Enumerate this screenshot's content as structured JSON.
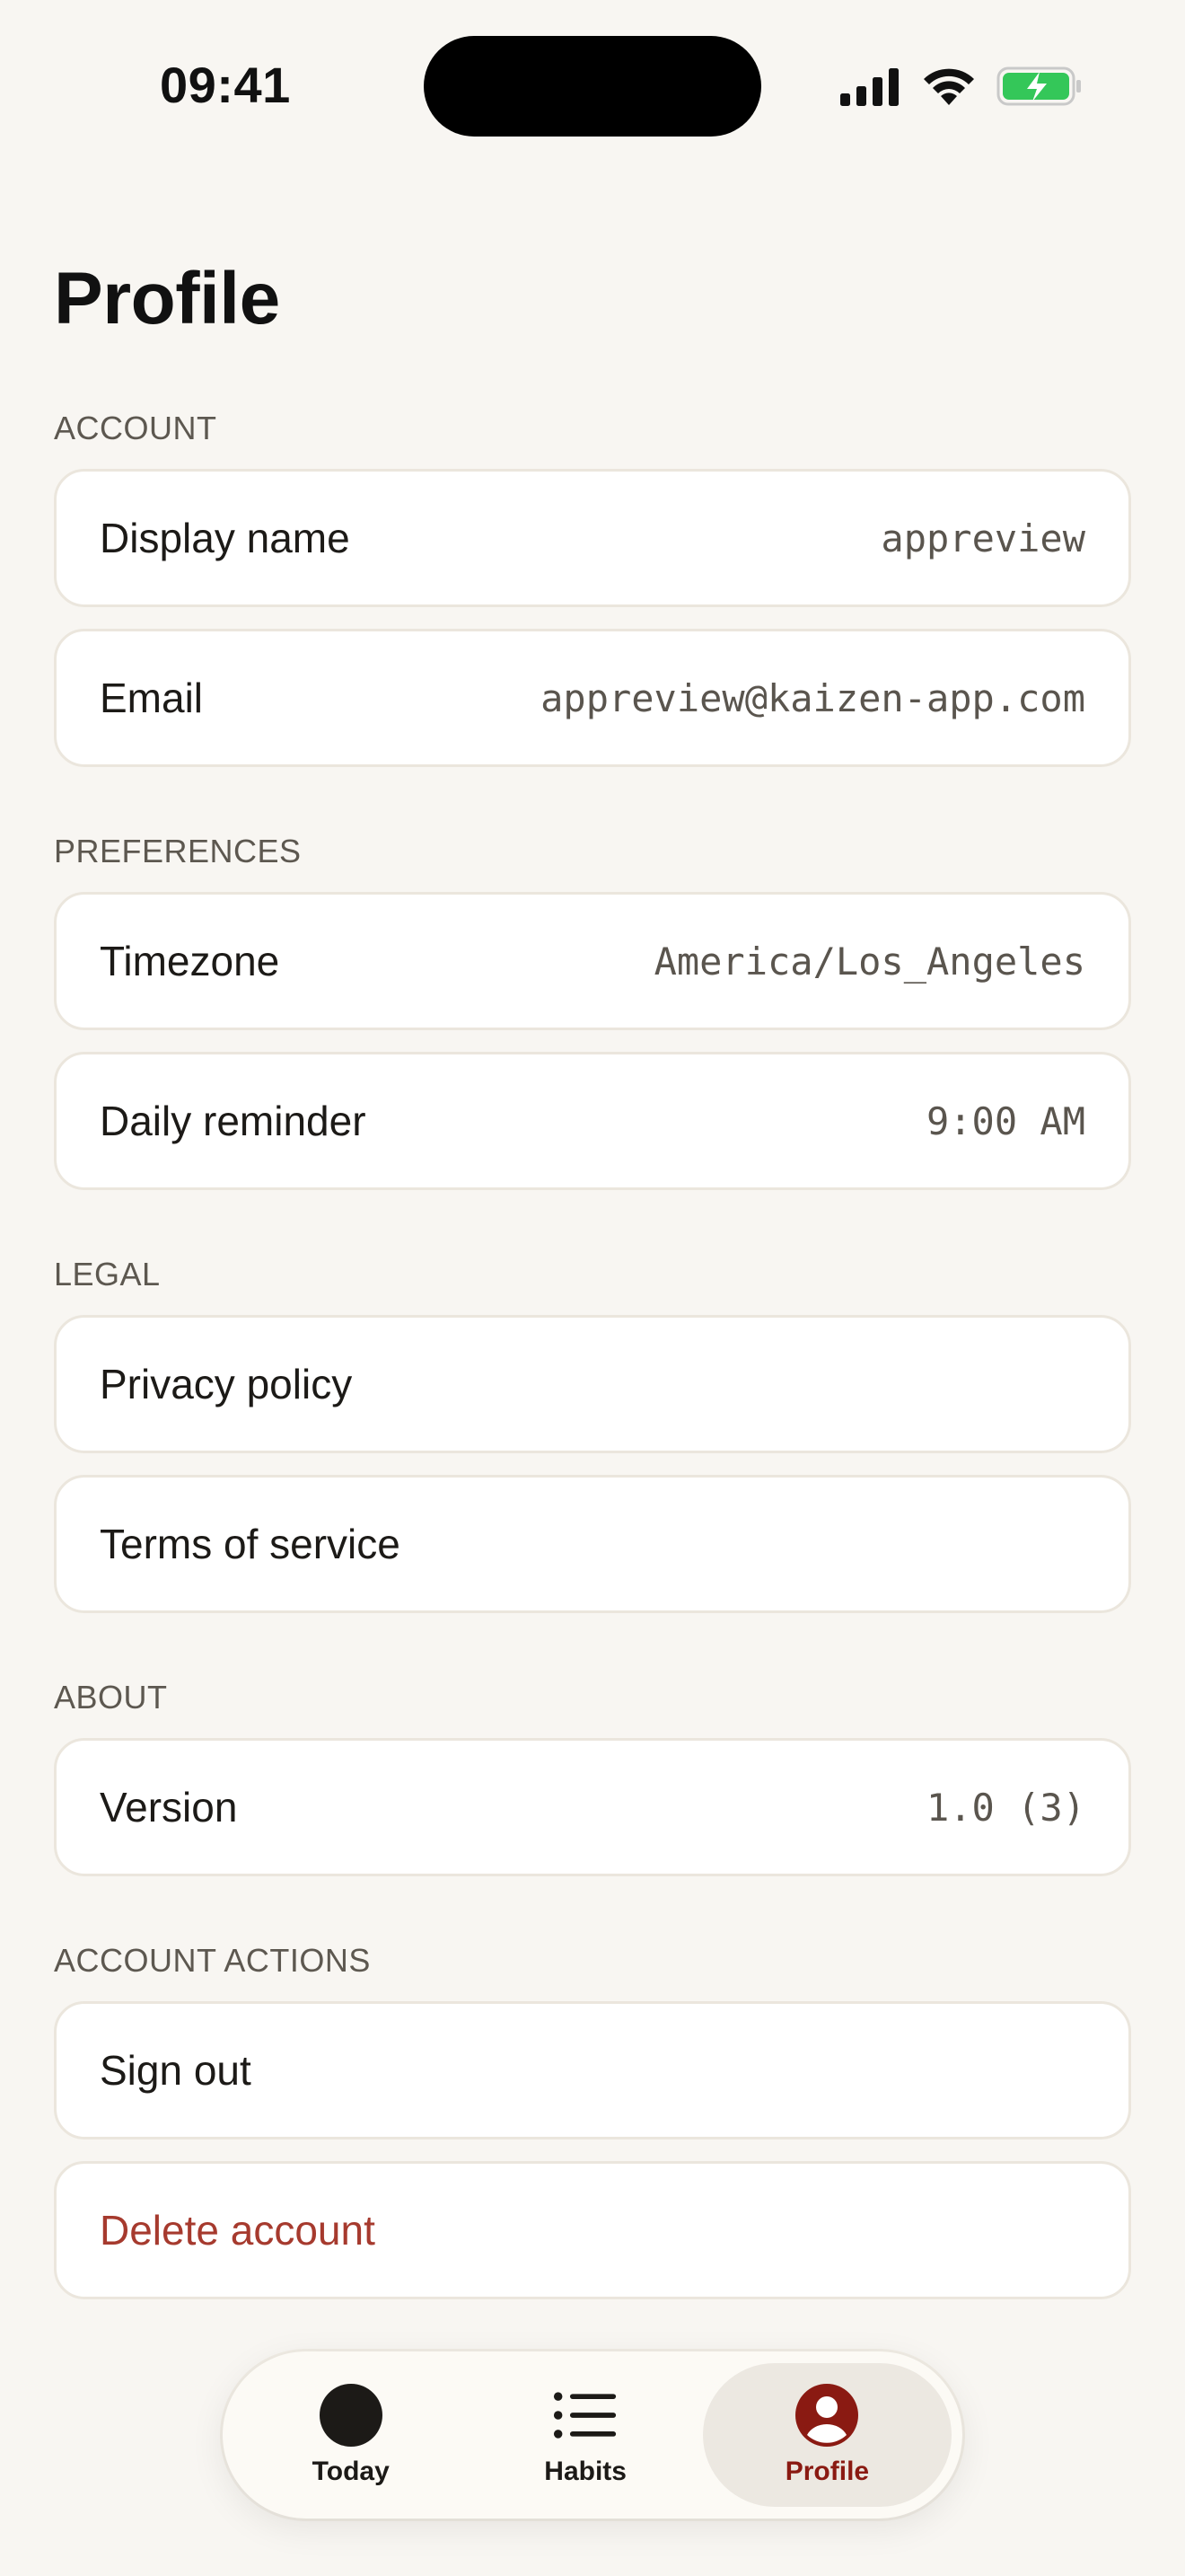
{
  "status_bar": {
    "time": "09:41"
  },
  "page": {
    "title": "Profile"
  },
  "sections": {
    "account": {
      "label": "ACCOUNT",
      "rows": [
        {
          "label": "Display name",
          "value": "appreview"
        },
        {
          "label": "Email",
          "value": "appreview@kaizen-app.com"
        }
      ]
    },
    "preferences": {
      "label": "PREFERENCES",
      "rows": [
        {
          "label": "Timezone",
          "value": "America/Los_Angeles"
        },
        {
          "label": "Daily reminder",
          "value": "9:00 AM"
        }
      ]
    },
    "legal": {
      "label": "LEGAL",
      "rows": [
        {
          "label": "Privacy policy"
        },
        {
          "label": "Terms of service"
        }
      ]
    },
    "about": {
      "label": "ABOUT",
      "rows": [
        {
          "label": "Version",
          "value": "1.0 (3)"
        }
      ]
    },
    "account_actions": {
      "label": "ACCOUNT ACTIONS",
      "rows": [
        {
          "label": "Sign out"
        },
        {
          "label": "Delete account"
        }
      ]
    }
  },
  "tab_bar": {
    "tabs": [
      {
        "label": "Today",
        "icon": "circle-icon"
      },
      {
        "label": "Habits",
        "icon": "list-icon"
      },
      {
        "label": "Profile",
        "icon": "person-icon",
        "active": true
      }
    ]
  },
  "colors": {
    "background": "#f8f6f2",
    "danger": "#a63a2e",
    "accent": "#8a1a12",
    "battery": "#34c759"
  }
}
